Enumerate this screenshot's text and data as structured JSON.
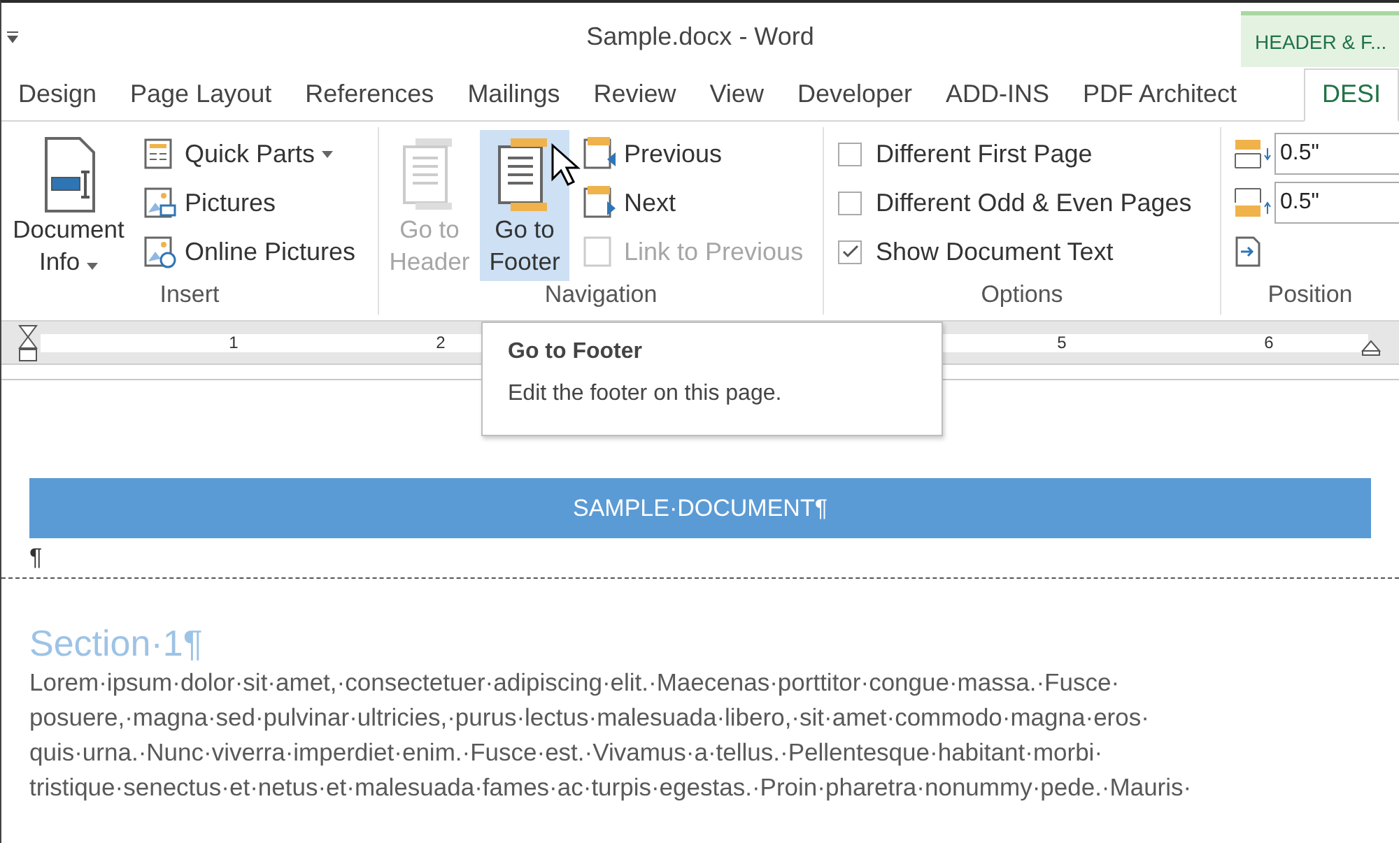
{
  "window": {
    "title": "Sample.docx - Word"
  },
  "contextual_tab": {
    "label": "HEADER & F..."
  },
  "tabs": [
    {
      "label": "Design",
      "selected": false
    },
    {
      "label": "Page Layout",
      "selected": false
    },
    {
      "label": "References",
      "selected": false
    },
    {
      "label": "Mailings",
      "selected": false
    },
    {
      "label": "Review",
      "selected": false
    },
    {
      "label": "View",
      "selected": false
    },
    {
      "label": "Developer",
      "selected": false
    },
    {
      "label": "ADD-INS",
      "selected": false
    },
    {
      "label": "PDF Architect",
      "selected": false
    },
    {
      "label": "DESI",
      "selected": true,
      "kind": "contextual"
    }
  ],
  "groups": [
    {
      "label": "Insert",
      "items": [
        {
          "kind": "large",
          "label": "Document Info",
          "dropdown": true,
          "disabled": false,
          "selected": false
        },
        {
          "kind": "small",
          "label": "Quick Parts",
          "dropdown": true,
          "disabled": false
        },
        {
          "kind": "small",
          "label": "Pictures",
          "dropdown": false,
          "disabled": false
        },
        {
          "kind": "small",
          "label": "Online Pictures",
          "dropdown": false,
          "disabled": false
        }
      ]
    },
    {
      "label": "Navigation",
      "items": [
        {
          "kind": "large",
          "label": "Go to Header",
          "dropdown": false,
          "disabled": true,
          "selected": false
        },
        {
          "kind": "large",
          "label": "Go to Footer",
          "dropdown": false,
          "disabled": false,
          "selected": true
        },
        {
          "kind": "small",
          "label": "Previous",
          "dropdown": false,
          "disabled": false
        },
        {
          "kind": "small",
          "label": "Next",
          "dropdown": false,
          "disabled": false
        },
        {
          "kind": "small",
          "label": "Link to Previous",
          "dropdown": false,
          "disabled": true
        }
      ]
    },
    {
      "label": "Options",
      "items": [
        {
          "kind": "check",
          "label": "Different First Page",
          "checked": false
        },
        {
          "kind": "check",
          "label": "Different Odd & Even Pages",
          "checked": false
        },
        {
          "kind": "check",
          "label": "Show Document Text",
          "checked": true
        }
      ]
    },
    {
      "label": "Position",
      "items": [
        {
          "kind": "field",
          "value": "0.5\""
        },
        {
          "kind": "field",
          "value": "0.5\""
        },
        {
          "kind": "icon"
        }
      ]
    }
  ],
  "ruler": {
    "numbers": [
      "1",
      "2",
      "5",
      "6"
    ]
  },
  "tooltip": {
    "title": "Go to Footer",
    "text": "Edit the footer on this page."
  },
  "document": {
    "header_banner": "SAMPLE·DOCUMENT¶",
    "header_mark": "¶",
    "heading": "Section·1¶",
    "body_lines": [
      "Lorem·ipsum·dolor·sit·amet,·consectetuer·adipiscing·elit.·Maecenas·porttitor·congue·massa.·Fusce·",
      "posuere,·magna·sed·pulvinar·ultricies,·purus·lectus·malesuada·libero,·sit·amet·commodo·magna·eros·",
      "quis·urna.·Nunc·viverra·imperdiet·enim.·Fusce·est.·Vivamus·a·tellus.·Pellentesque·habitant·morbi·",
      "tristique·senectus·et·netus·et·malesuada·fames·ac·turpis·egestas.·Proin·pharetra·nonummy·pede.·Mauris·"
    ]
  }
}
